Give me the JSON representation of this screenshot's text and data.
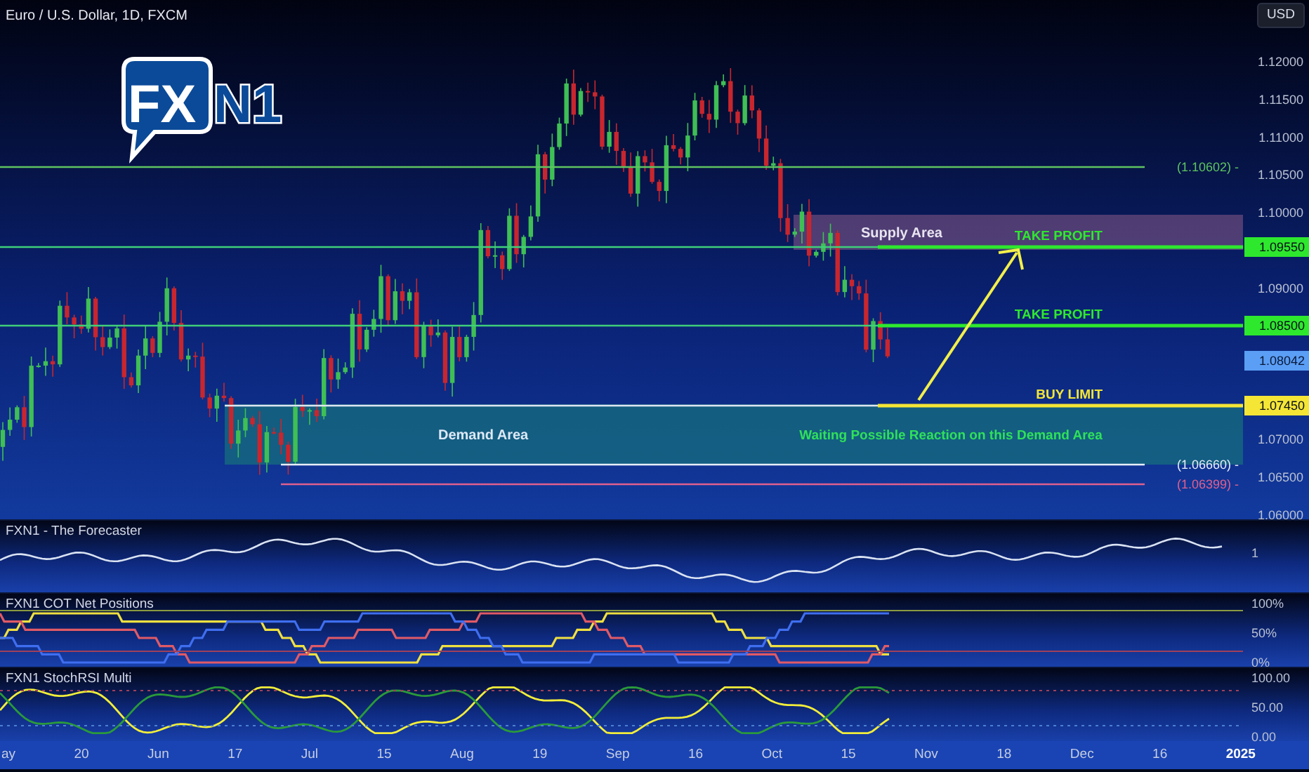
{
  "header": {
    "title": "Euro / U.S. Dollar, 1D, FXCM",
    "currency_button": "USD"
  },
  "logo": {
    "text_1": "FX",
    "text_2": "N1"
  },
  "price_axis": {
    "ticks": [
      "1.12000",
      "1.11500",
      "1.11000",
      "1.10500",
      "1.10000",
      "1.09000",
      "1.07000",
      "1.06500",
      "1.06000"
    ]
  },
  "zones": [
    {
      "kind": "supply",
      "label": "Supply Area"
    },
    {
      "kind": "demand",
      "label": "Demand Area"
    }
  ],
  "price_levels": [
    {
      "label": "(1.10602) -",
      "color": "#5ec460"
    },
    {
      "label": "(1.06660) -",
      "color": "#e8eef8"
    },
    {
      "label": "(1.06399) -",
      "color": "#e0608e"
    }
  ],
  "trade_levels": [
    {
      "tag": "1.09550",
      "note": "TAKE PROFIT",
      "color": "#2ee82e"
    },
    {
      "tag": "1.08500",
      "note": "TAKE PROFIT",
      "color": "#2ee82e"
    },
    {
      "tag": "1.07450",
      "note": "BUY LIMIT",
      "color": "#f5e636"
    }
  ],
  "last_price": {
    "tag": "1.08042"
  },
  "demand_note": "Waiting Possible Reaction on this Demand Area",
  "indicators": [
    {
      "title": "FXN1 - The Forecaster",
      "axis_labels": [
        "1"
      ]
    },
    {
      "title": "FXN1 COT Net Positions",
      "axis_labels": [
        "100%",
        "50%",
        "0%"
      ]
    },
    {
      "title": "FXN1 StochRSI Multi",
      "axis_labels": [
        "100.00",
        "50.00",
        "0.00"
      ]
    }
  ],
  "time_axis": [
    {
      "label": "ay",
      "emphasized": false
    },
    {
      "label": "20",
      "emphasized": false
    },
    {
      "label": "Jun",
      "emphasized": false
    },
    {
      "label": "17",
      "emphasized": false
    },
    {
      "label": "Jul",
      "emphasized": false
    },
    {
      "label": "15",
      "emphasized": false
    },
    {
      "label": "Aug",
      "emphasized": false
    },
    {
      "label": "19",
      "emphasized": false
    },
    {
      "label": "Sep",
      "emphasized": false
    },
    {
      "label": "16",
      "emphasized": false
    },
    {
      "label": "Oct",
      "emphasized": false
    },
    {
      "label": "15",
      "emphasized": false
    },
    {
      "label": "Nov",
      "emphasized": false
    },
    {
      "label": "18",
      "emphasized": false
    },
    {
      "label": "Dec",
      "emphasized": false
    },
    {
      "label": "16",
      "emphasized": false
    },
    {
      "label": "2025",
      "emphasized": true
    }
  ]
}
